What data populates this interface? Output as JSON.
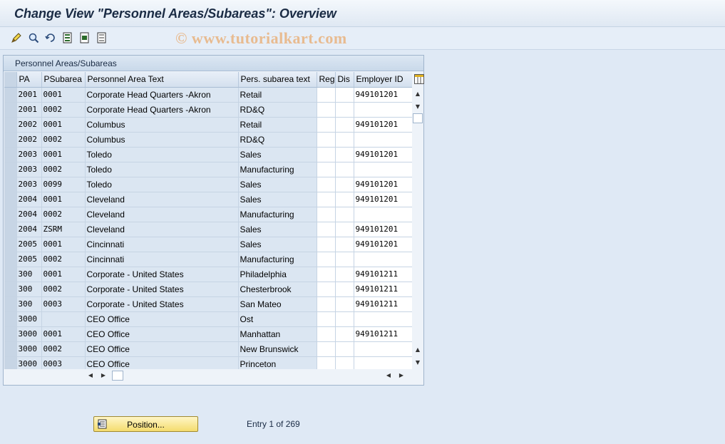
{
  "window": {
    "title": "Change View \"Personnel Areas/Subareas\": Overview"
  },
  "toolbar": {
    "icons": [
      "edit-pencil-icon",
      "find-icon",
      "refresh-icon",
      "select-all-icon",
      "select-block-icon",
      "deselect-all-icon"
    ],
    "watermark": "© www.tutorialkart.com"
  },
  "panel": {
    "title": "Personnel Areas/Subareas",
    "columns": {
      "pa": "PA",
      "psubarea": "PSubarea",
      "area_text": "Personnel Area Text",
      "subarea_text": "Pers. subarea text",
      "reg": "Reg",
      "dis": "Dis",
      "employer_id": "Employer ID"
    },
    "rows": [
      {
        "pa": "2001",
        "psubarea": "0001",
        "area_text": "Corporate Head Quarters -Akron",
        "subarea_text": "Retail",
        "reg": "",
        "dis": "",
        "employer_id": "949101201"
      },
      {
        "pa": "2001",
        "psubarea": "0002",
        "area_text": "Corporate Head Quarters -Akron",
        "subarea_text": "RD&Q",
        "reg": "",
        "dis": "",
        "employer_id": ""
      },
      {
        "pa": "2002",
        "psubarea": "0001",
        "area_text": "Columbus",
        "subarea_text": "Retail",
        "reg": "",
        "dis": "",
        "employer_id": "949101201"
      },
      {
        "pa": "2002",
        "psubarea": "0002",
        "area_text": "Columbus",
        "subarea_text": "RD&Q",
        "reg": "",
        "dis": "",
        "employer_id": ""
      },
      {
        "pa": "2003",
        "psubarea": "0001",
        "area_text": "Toledo",
        "subarea_text": "Sales",
        "reg": "",
        "dis": "",
        "employer_id": "949101201"
      },
      {
        "pa": "2003",
        "psubarea": "0002",
        "area_text": "Toledo",
        "subarea_text": "Manufacturing",
        "reg": "",
        "dis": "",
        "employer_id": ""
      },
      {
        "pa": "2003",
        "psubarea": "0099",
        "area_text": "Toledo",
        "subarea_text": "Sales",
        "reg": "",
        "dis": "",
        "employer_id": "949101201"
      },
      {
        "pa": "2004",
        "psubarea": "0001",
        "area_text": "Cleveland",
        "subarea_text": "Sales",
        "reg": "",
        "dis": "",
        "employer_id": "949101201"
      },
      {
        "pa": "2004",
        "psubarea": "0002",
        "area_text": "Cleveland",
        "subarea_text": "Manufacturing",
        "reg": "",
        "dis": "",
        "employer_id": ""
      },
      {
        "pa": "2004",
        "psubarea": "ZSRM",
        "area_text": "Cleveland",
        "subarea_text": "Sales",
        "reg": "",
        "dis": "",
        "employer_id": "949101201"
      },
      {
        "pa": "2005",
        "psubarea": "0001",
        "area_text": "Cincinnati",
        "subarea_text": "Sales",
        "reg": "",
        "dis": "",
        "employer_id": "949101201"
      },
      {
        "pa": "2005",
        "psubarea": "0002",
        "area_text": "Cincinnati",
        "subarea_text": "Manufacturing",
        "reg": "",
        "dis": "",
        "employer_id": ""
      },
      {
        "pa": "300",
        "psubarea": "0001",
        "area_text": "Corporate - United States",
        "subarea_text": "Philadelphia",
        "reg": "",
        "dis": "",
        "employer_id": "949101211"
      },
      {
        "pa": "300",
        "psubarea": "0002",
        "area_text": "Corporate - United States",
        "subarea_text": "Chesterbrook",
        "reg": "",
        "dis": "",
        "employer_id": "949101211"
      },
      {
        "pa": "300",
        "psubarea": "0003",
        "area_text": "Corporate - United States",
        "subarea_text": "San Mateo",
        "reg": "",
        "dis": "",
        "employer_id": "949101211"
      },
      {
        "pa": "3000",
        "psubarea": "",
        "area_text": "CEO Office",
        "subarea_text": "Ost",
        "reg": "",
        "dis": "",
        "employer_id": ""
      },
      {
        "pa": "3000",
        "psubarea": "0001",
        "area_text": "CEO Office",
        "subarea_text": "Manhattan",
        "reg": "",
        "dis": "",
        "employer_id": "949101211"
      },
      {
        "pa": "3000",
        "psubarea": "0002",
        "area_text": "CEO Office",
        "subarea_text": "New Brunswick",
        "reg": "",
        "dis": "",
        "employer_id": ""
      },
      {
        "pa": "3000",
        "psubarea": "0003",
        "area_text": "CEO Office",
        "subarea_text": "Princeton",
        "reg": "",
        "dis": "",
        "employer_id": ""
      }
    ]
  },
  "footer": {
    "position_button": "Position...",
    "entry_info": "Entry 1 of 269"
  },
  "colors": {
    "title_text": "#1a2b44",
    "readonly_cell": "#dbe6f2",
    "editable_cell": "#ffffff",
    "button_fill": "#f4dc6e"
  }
}
